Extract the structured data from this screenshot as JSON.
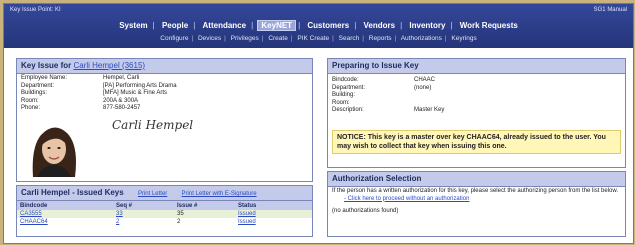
{
  "header": {
    "left_text": "Key Issue Point: KI",
    "right_text": "SG1 Manual"
  },
  "main_nav": [
    "System",
    "People",
    "Attendance",
    "KeyNET",
    "Customers",
    "Vendors",
    "Inventory",
    "Work Requests"
  ],
  "sub_nav": [
    "Configure",
    "Devices",
    "Privileges",
    "Create",
    "PIK Create",
    "Search",
    "Reports",
    "Authorizations",
    "Keyrings"
  ],
  "key_issue": {
    "title_prefix": "Key Issue for",
    "person_link": "Carli Hempel (3615)",
    "fields": [
      {
        "label": "Employee Name:",
        "value": "Hempel, Carli"
      },
      {
        "label": "Department:",
        "value": "[PA] Performing Arts Drama"
      },
      {
        "label": "Buildings:",
        "value": "[MFA] Music & Fine Arts"
      },
      {
        "label": "Room:",
        "value": "200A & 300A"
      },
      {
        "label": "Phone:",
        "value": "877-580-2457"
      }
    ],
    "signature": "Carli Hempel"
  },
  "issued_keys": {
    "title": "Carli Hempel - Issued Keys",
    "print_letter": "Print Letter",
    "print_letter_sig": "Print Letter with E-Signature",
    "columns": [
      "Bindcode",
      "Seq #",
      "Issue #",
      "Status"
    ],
    "rows": [
      {
        "bindcode": "CA3555",
        "seq": "33",
        "issue": "35",
        "status": "Issued"
      },
      {
        "bindcode": "CHAAC64",
        "seq": "2",
        "issue": "2",
        "status": "Issued"
      }
    ]
  },
  "preparing": {
    "title": "Preparing to Issue Key",
    "fields": [
      {
        "label": "Bindcode:",
        "value": "CHAAC"
      },
      {
        "label": "Department:",
        "value": "(none)"
      },
      {
        "label": "Building:",
        "value": ""
      },
      {
        "label": "Room:",
        "value": ""
      },
      {
        "label": "Description:",
        "value": "Master Key"
      }
    ],
    "notice": "NOTICE: This key is a master over key CHAAC64, already issued to the user. You may wish to collect that key when issuing this one."
  },
  "authorization": {
    "title": "Authorization Selection",
    "text": "If the person has a written authorization for this key, please select the authorizing person from the list below.",
    "proceed_link": "- Click here to proceed without an authorization",
    "empty": "(no authorizations found)"
  }
}
